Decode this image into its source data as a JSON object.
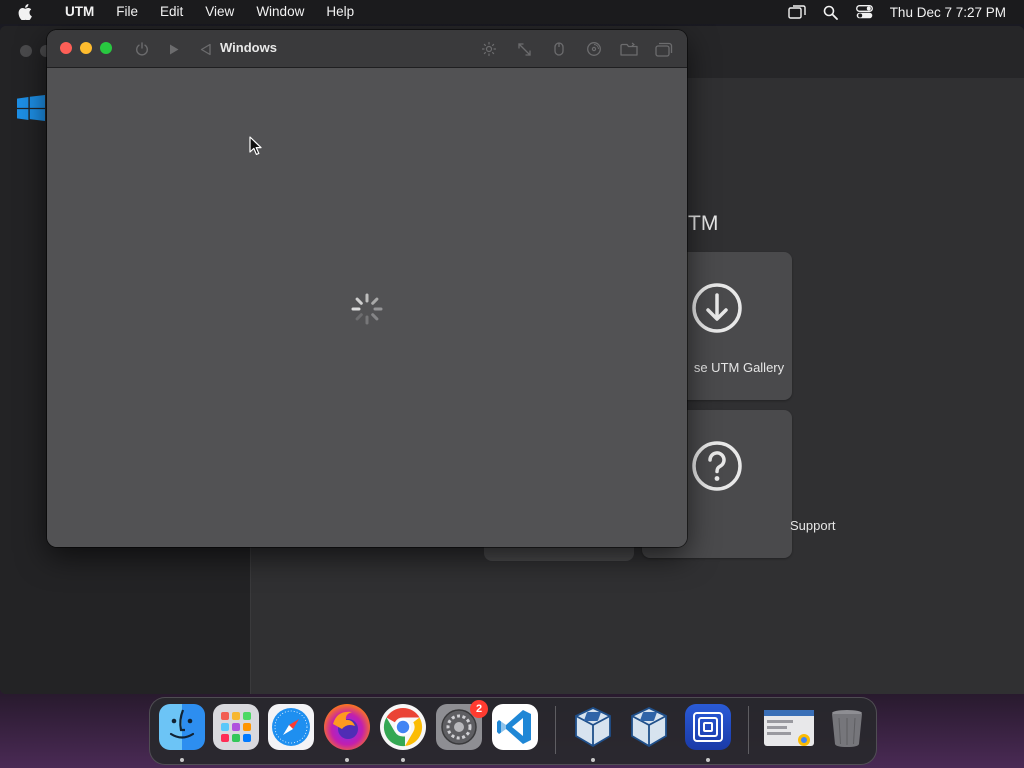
{
  "menubar": {
    "app_name": "UTM",
    "items": [
      "File",
      "Edit",
      "View",
      "Window",
      "Help"
    ],
    "clock": "Thu Dec 7  7:27 PM"
  },
  "utm_main": {
    "welcome_title_visible": "TM",
    "tiles": [
      {
        "label": "se UTM Gallery",
        "icon": "download-circle-icon"
      },
      {
        "label": "Support",
        "icon": "question-circle-icon"
      }
    ]
  },
  "vm_window": {
    "title": "Windows",
    "status": "loading"
  },
  "dock": {
    "apps": [
      {
        "name": "Finder",
        "icon": "finder-icon"
      },
      {
        "name": "Launchpad",
        "icon": "launchpad-icon"
      },
      {
        "name": "Safari",
        "icon": "safari-icon"
      },
      {
        "name": "Firefox",
        "icon": "firefox-icon"
      },
      {
        "name": "Chrome",
        "icon": "chrome-icon"
      },
      {
        "name": "System Settings",
        "icon": "settings-icon",
        "badge": "2"
      },
      {
        "name": "Visual Studio Code",
        "icon": "vscode-icon"
      },
      {
        "name": "VirtualBox",
        "icon": "virtualbox-icon"
      },
      {
        "name": "VirtualBox",
        "icon": "virtualbox-icon"
      },
      {
        "name": "UTM",
        "icon": "utm-icon"
      },
      {
        "name": "Screenshot",
        "icon": "screenshot-thumbnail-icon"
      },
      {
        "name": "Trash",
        "icon": "trash-icon"
      }
    ]
  },
  "colors": {
    "close": "#fe5f57",
    "minimize": "#febc2e",
    "maximize": "#28c840",
    "badge": "#ff3b30"
  }
}
